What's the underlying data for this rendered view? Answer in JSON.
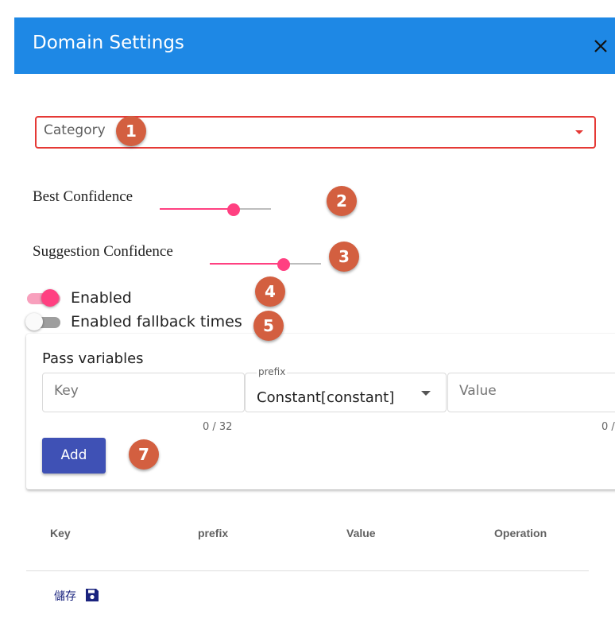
{
  "dialog": {
    "title": "Domain Settings",
    "close_icon": "close-icon",
    "header_color": "#1e88e5"
  },
  "form": {
    "category": {
      "placeholder": "Category",
      "error_color": "#e53935"
    },
    "best_confidence": {
      "label": "Best Confidence",
      "value_fraction": 0.67
    },
    "suggestion_confidence": {
      "label": "Suggestion Confidence",
      "value_fraction": 0.67
    },
    "enabled": {
      "label": "Enabled",
      "on": true
    },
    "fallback": {
      "label": "Enabled fallback times",
      "on": false
    }
  },
  "pass_variables": {
    "title": "Pass variables",
    "key": {
      "placeholder": "Key",
      "counter": "0 / 32"
    },
    "prefix": {
      "label": "prefix",
      "value": "Constant[constant]"
    },
    "value": {
      "placeholder": "Value",
      "counter": "0 /"
    },
    "add_label": "Add"
  },
  "table": {
    "columns": [
      "Key",
      "prefix",
      "Value",
      "Operation"
    ]
  },
  "footer": {
    "save_label": "儲存",
    "save_icon": "save-icon"
  },
  "badges": [
    "1",
    "2",
    "3",
    "4",
    "5",
    "7"
  ],
  "colors": {
    "accent": "#ff4081",
    "primary_button": "#3f51b5",
    "badge": "#d35f40"
  }
}
